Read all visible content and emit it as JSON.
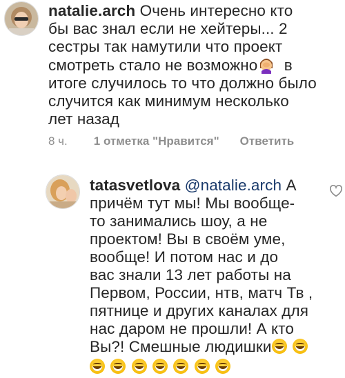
{
  "comments": [
    {
      "username": "natalie.arch",
      "lines": [
        "Очень интересно кто",
        "бы вас знал если не хейтеры... 2",
        "сестры так намутили что проект",
        "смотреть стало не возможно",
        "итоге случилось то что должно было",
        "случится как минимум несколько",
        "лет назад"
      ],
      "line4_tail": "в",
      "emoji": "facepalm-emoji",
      "meta": {
        "time": "8 ч.",
        "likes": "1 отметка \"Нравится\"",
        "reply": "Ответить"
      }
    },
    {
      "username": "tatasvetlova",
      "mention": "@natalie.arch",
      "line1_tail": "А",
      "lines": [
        "причём тут мы! Мы вообще-",
        "то занимались шоу, а не",
        "проектом! Вы в своём уме,",
        "вообще! И потом нас и до",
        "вас знали 13 лет работы на",
        "Первом, России, нтв, матч Тв ,",
        "пятнице и других каналах для",
        "нас даром не прошли! А кто",
        "Вы?! Смешные людишки"
      ],
      "emoji": "grinning-face-emoji"
    }
  ]
}
